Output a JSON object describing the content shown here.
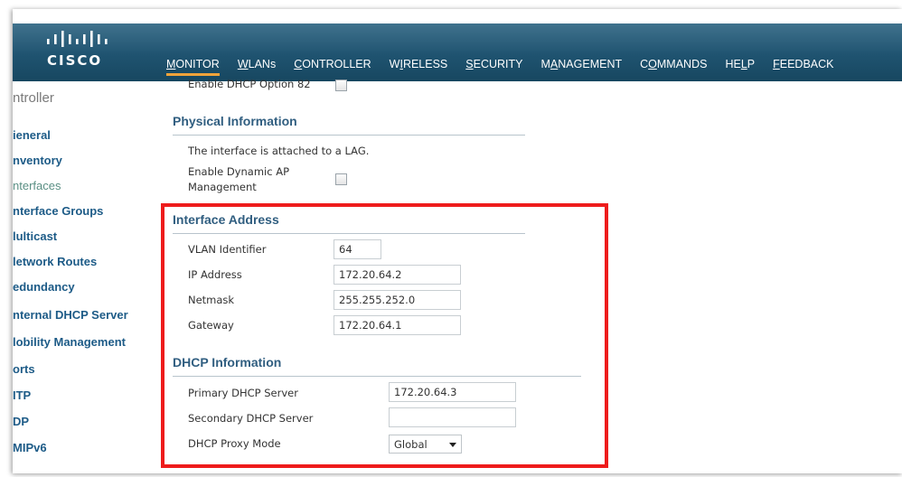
{
  "brand": {
    "logo_text": "CISCO"
  },
  "menu": [
    {
      "pre": "",
      "ul": "M",
      "post": "ONITOR",
      "active": true
    },
    {
      "pre": "",
      "ul": "W",
      "post": "LANs",
      "active": false
    },
    {
      "pre": "",
      "ul": "C",
      "post": "ONTROLLER",
      "active": false
    },
    {
      "pre": "W",
      "ul": "I",
      "post": "RELESS",
      "active": false
    },
    {
      "pre": "",
      "ul": "S",
      "post": "ECURITY",
      "active": false
    },
    {
      "pre": "M",
      "ul": "A",
      "post": "NAGEMENT",
      "active": false
    },
    {
      "pre": "C",
      "ul": "O",
      "post": "MMANDS",
      "active": false
    },
    {
      "pre": "HE",
      "ul": "L",
      "post": "P",
      "active": false
    },
    {
      "pre": "",
      "ul": "F",
      "post": "EEDBACK",
      "active": false
    }
  ],
  "sidebar": {
    "title": "ntroller",
    "items": [
      {
        "label": "ieneral"
      },
      {
        "label": "nventory"
      },
      {
        "label": "nterfaces",
        "active": true
      },
      {
        "label": "nterface Groups"
      },
      {
        "label": "lulticast"
      },
      {
        "label": "letwork Routes"
      },
      {
        "label": "edundancy"
      },
      {
        "label": "nternal DHCP Server"
      },
      {
        "label": "lobility Management"
      },
      {
        "label": "orts"
      },
      {
        "label": "ITP"
      },
      {
        "label": "DP"
      },
      {
        "label": "MIPv6"
      }
    ]
  },
  "form": {
    "dhcp_option82_label": "Enable DHCP Option 82",
    "dhcp_option82_checked": false,
    "physical": {
      "title": "Physical Information",
      "lag_text": "The interface is attached to a LAG.",
      "dyn_ap_label_1": "Enable Dynamic AP",
      "dyn_ap_label_2": "Management",
      "dyn_ap_checked": false
    },
    "interface_address": {
      "title": "Interface Address",
      "vlan_label": "VLAN Identifier",
      "vlan_value": "64",
      "ip_label": "IP Address",
      "ip_value": "172.20.64.2",
      "netmask_label": "Netmask",
      "netmask_value": "255.255.252.0",
      "gateway_label": "Gateway",
      "gateway_value": "172.20.64.1"
    },
    "dhcp": {
      "title": "DHCP Information",
      "primary_label": "Primary DHCP Server",
      "primary_value": "172.20.64.3",
      "secondary_label": "Secondary DHCP Server",
      "secondary_value": "",
      "proxy_label": "DHCP Proxy Mode",
      "proxy_value": "Global"
    }
  },
  "colors": {
    "header": "#1f5370",
    "active_tab": "#f2a33a",
    "link": "#1d5b87",
    "section_title": "#305e80",
    "highlight": "#ee1c1c"
  }
}
